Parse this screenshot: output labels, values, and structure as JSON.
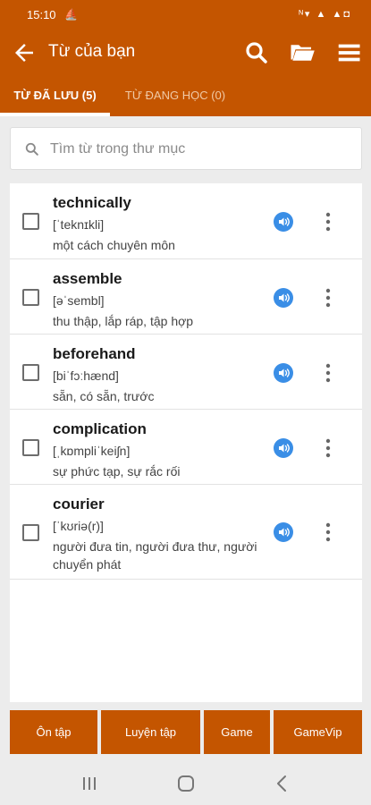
{
  "status_bar": {
    "time": "15:10",
    "indicators": "ᴺ▾ ▲ ▲◘"
  },
  "app_bar": {
    "title": "Từ của bạn",
    "back_icon": "back-arrow-icon",
    "actions": [
      "search-icon",
      "folder-icon",
      "menu-icon"
    ]
  },
  "tabs": [
    {
      "label": "TỪ ĐÃ LƯU (5)",
      "active": true
    },
    {
      "label": "TỪ ĐANG HỌC (0)",
      "active": false
    }
  ],
  "search": {
    "placeholder": "Tìm từ trong thư mục",
    "value": ""
  },
  "words": [
    {
      "word": "technically",
      "ipa": "[ˈteknɪkli]",
      "meaning": "một cách chuyên môn",
      "checked": false
    },
    {
      "word": "assemble",
      "ipa": "[əˈsembl]",
      "meaning": "thu thập, lắp ráp, tập hợp",
      "checked": false
    },
    {
      "word": "beforehand",
      "ipa": "[biˈfɔːhænd]",
      "meaning": "sẵn, có sẵn, trước",
      "checked": false
    },
    {
      "word": "complication",
      "ipa": "[ˌkɒmpliˈkeiʃn]",
      "meaning": "sự phức tạp, sự rắc rối",
      "checked": false
    },
    {
      "word": "courier",
      "ipa": "[ˈkʊriə(r)]",
      "meaning": "người đưa tin, người đưa thư, người chuyển phát",
      "checked": false
    }
  ],
  "bottom_buttons": [
    "Ôn tập",
    "Luyện tập",
    "Game",
    "GameVip"
  ],
  "colors": {
    "primary": "#c45500",
    "audio_icon": "#3a8ee6",
    "background": "#ececec"
  },
  "nav_bar": [
    "recents-icon",
    "home-icon",
    "back-icon"
  ]
}
